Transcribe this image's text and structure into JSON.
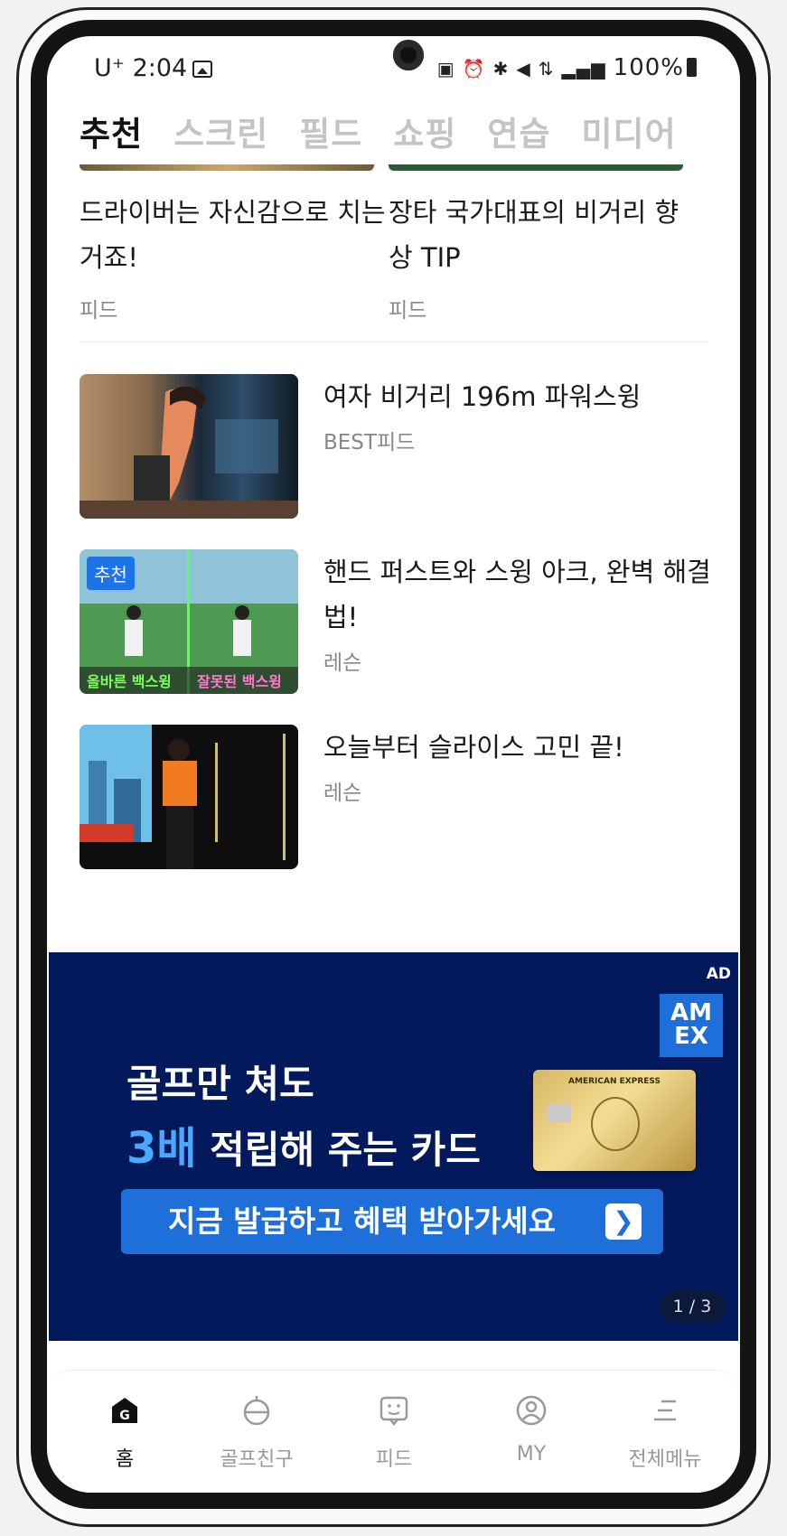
{
  "status_bar": {
    "carrier_time": "U⁺ 2:04",
    "right_text": "100%",
    "icons": [
      "image-icon",
      "lock-icon",
      "alarm-icon",
      "bluetooth-icon",
      "mute-icon",
      "5g-icon",
      "signal-icon",
      "battery-icon"
    ]
  },
  "tabs": [
    {
      "label": "추천",
      "active": true
    },
    {
      "label": "스크린",
      "active": false
    },
    {
      "label": "필드",
      "active": false
    },
    {
      "label": "쇼핑",
      "active": false
    },
    {
      "label": "연습",
      "active": false
    },
    {
      "label": "미디어",
      "active": false
    }
  ],
  "top_cards": [
    {
      "title": "드라이버는 자신감으로 치는거죠!",
      "category": "피드"
    },
    {
      "title": "장타 국가대표의 비거리 향상 TIP",
      "category": "피드"
    }
  ],
  "list": [
    {
      "title": "여자 비거리 196m 파워스윙",
      "category": "BEST피드",
      "badge": ""
    },
    {
      "title": "핸드 퍼스트와 스윙 아크, 완벽 해결법!",
      "category": "레슨",
      "badge": "추천",
      "thumb_labels": [
        "올바른 백스윙",
        "잘못된 백스윙"
      ]
    },
    {
      "title": "오늘부터 슬라이스 고민 끝!",
      "category": "레슨",
      "badge": ""
    }
  ],
  "ad": {
    "tag": "AD",
    "brand_top": "AM",
    "brand_bottom": "EX",
    "headline1": "골프만 쳐도",
    "headline2_highlight": "3배",
    "headline2_rest": " 적립해 주는 카드",
    "card_text": "AMERICAN EXPRESS",
    "cta": "지금 발급하고 혜택 받아가세요",
    "cta_arrow": "❯",
    "pager": "1 / 3"
  },
  "bottom_nav": [
    {
      "label": "홈",
      "icon": "home-icon",
      "active": true
    },
    {
      "label": "골프친구",
      "icon": "golf-friend-icon",
      "active": false
    },
    {
      "label": "피드",
      "icon": "feed-icon",
      "active": false
    },
    {
      "label": "MY",
      "icon": "profile-icon",
      "active": false
    },
    {
      "label": "전체메뉴",
      "icon": "menu-icon",
      "active": false
    }
  ],
  "colors": {
    "accent_blue": "#1e73e6",
    "ad_background": "#021a5b",
    "highlight": "#4aa8ff"
  }
}
